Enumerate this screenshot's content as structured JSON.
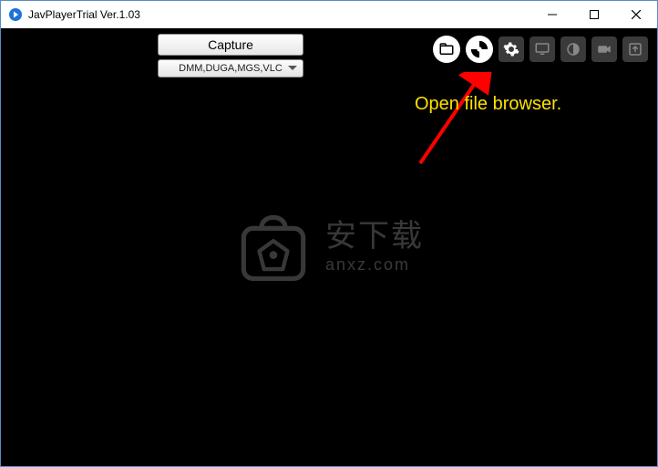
{
  "window": {
    "title": "JavPlayerTrial Ver.1.03"
  },
  "toolbar": {
    "capture_label": "Capture",
    "dropdown_value": "DMM,DUGA,MGS,VLC"
  },
  "icons": {
    "open_file": "folder",
    "controller": "dpad",
    "settings": "gear",
    "monitor": "monitor",
    "brightness": "contrast",
    "record": "camera",
    "export": "share-frame"
  },
  "annotation": {
    "text": "Open file browser."
  },
  "watermark": {
    "cn": "安下载",
    "en": "anxz.com"
  }
}
